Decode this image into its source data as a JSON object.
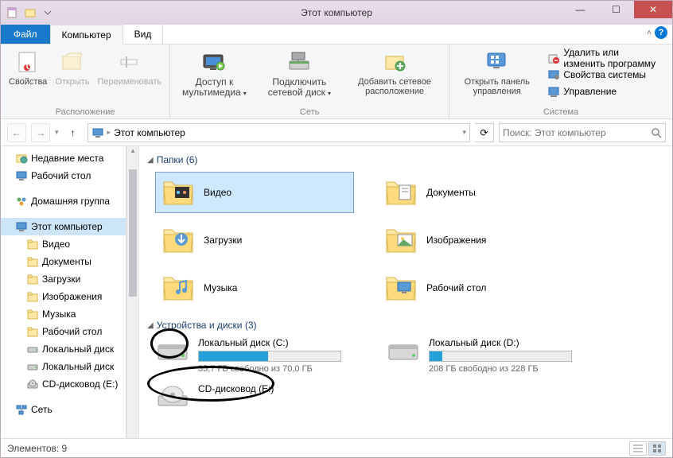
{
  "window": {
    "title": "Этот компьютер"
  },
  "menubar": {
    "file": "Файл",
    "tabs": [
      "Компьютер",
      "Вид"
    ]
  },
  "ribbon": {
    "group1": {
      "title": "Расположение",
      "items": [
        "Свойства",
        "Открыть",
        "Переименовать"
      ]
    },
    "group2": {
      "title": "Сеть",
      "items": [
        "Доступ к мультимедиа",
        "Подключить сетевой диск",
        "Добавить сетевое расположение"
      ]
    },
    "group3": {
      "items": [
        "Открыть панель управления"
      ]
    },
    "system": {
      "title": "Система",
      "rows": [
        "Удалить или изменить программу",
        "Свойства системы",
        "Управление"
      ]
    }
  },
  "breadcrumb": {
    "path": "Этот компьютер"
  },
  "search": {
    "placeholder": "Поиск: Этот компьютер"
  },
  "sidebar": {
    "items": [
      {
        "label": "Недавние места",
        "icon": "recent"
      },
      {
        "label": "Рабочий стол",
        "icon": "desktop"
      },
      {
        "label": "",
        "spacer": true
      },
      {
        "label": "Домашняя группа",
        "icon": "homegroup"
      },
      {
        "label": "",
        "spacer": true
      },
      {
        "label": "Этот компьютер",
        "icon": "computer",
        "active": true
      },
      {
        "label": "Видео",
        "icon": "folder",
        "indent": true
      },
      {
        "label": "Документы",
        "icon": "folder",
        "indent": true
      },
      {
        "label": "Загрузки",
        "icon": "folder",
        "indent": true
      },
      {
        "label": "Изображения",
        "icon": "folder",
        "indent": true
      },
      {
        "label": "Музыка",
        "icon": "folder",
        "indent": true
      },
      {
        "label": "Рабочий стол",
        "icon": "folder",
        "indent": true
      },
      {
        "label": "Локальный диск",
        "icon": "drive",
        "indent": true
      },
      {
        "label": "Локальный диск",
        "icon": "drive",
        "indent": true
      },
      {
        "label": "CD-дисковод (E:)",
        "icon": "cd",
        "indent": true
      },
      {
        "label": "",
        "spacer": true
      },
      {
        "label": "Сеть",
        "icon": "network"
      }
    ]
  },
  "main": {
    "folders_header": "Папки (6)",
    "folders": [
      {
        "label": "Видео",
        "sel": true,
        "type": "video"
      },
      {
        "label": "Документы",
        "type": "doc"
      },
      {
        "label": "Загрузки",
        "type": "download"
      },
      {
        "label": "Изображения",
        "type": "pic"
      },
      {
        "label": "Музыка",
        "type": "music"
      },
      {
        "label": "Рабочий стол",
        "type": "desktop"
      }
    ],
    "drives_header": "Устройства и диски (3)",
    "drives": [
      {
        "name": "Локальный диск (C:)",
        "free": "35,7 ГБ свободно из 70,0 ГБ",
        "fill": 49
      },
      {
        "name": "Локальный диск (D:)",
        "free": "208 ГБ свободно из 228 ГБ",
        "fill": 9
      },
      {
        "name": "CD-дисковод (E:)",
        "free": "",
        "fill": -1,
        "icon": "cd"
      }
    ]
  },
  "status": {
    "text": "Элементов: 9"
  }
}
